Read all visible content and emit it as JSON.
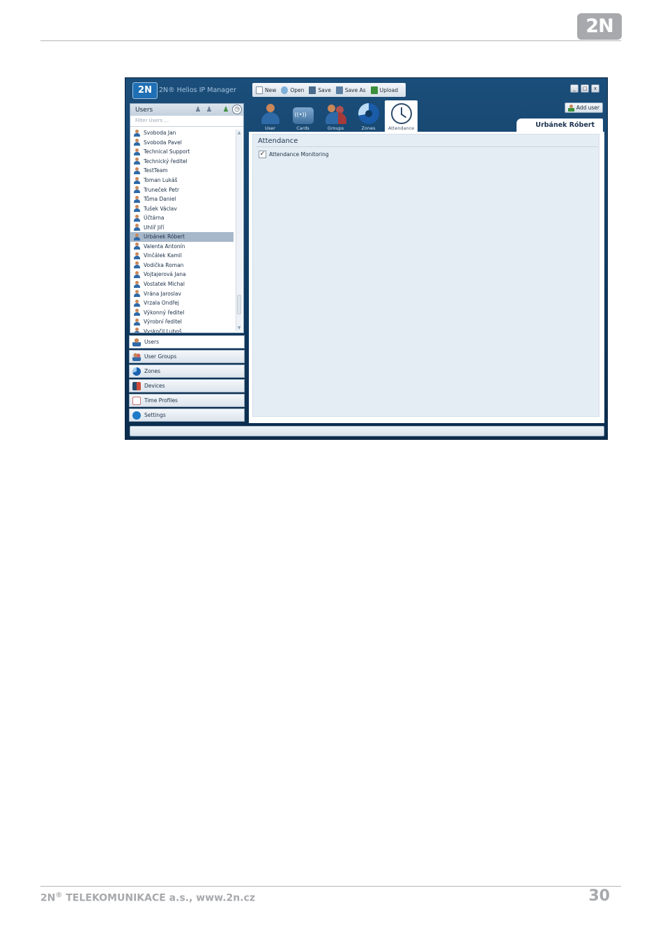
{
  "page": {
    "logo_text": "2N",
    "footer_brand": "2N",
    "footer_reg": "®",
    "footer_rest": " TELEKOMUNIKACE a.s., www.2n.cz",
    "page_number": "30"
  },
  "app": {
    "logo_text": "2N",
    "title": "2N® Helios IP Manager",
    "toolbar": {
      "new": "New",
      "open": "Open",
      "save": "Save",
      "save_as": "Save As",
      "upload": "Upload"
    },
    "window_buttons": [
      "_",
      "□",
      "x"
    ],
    "users_panel": {
      "title": "Users",
      "filter_placeholder": "Filter Users ...",
      "users": [
        "Svoboda Jan",
        "Svoboda Pavel",
        "Technical Support",
        "Technický ředitel",
        "TestTeam",
        "Toman Lukáš",
        "Truneček Petr",
        "Tůma Daniel",
        "Tušek Václav",
        "Účtárna",
        "Uhlíř Jiří",
        "Urbánek Róbert",
        "Valenta Antonín",
        "Vinčálek Kamil",
        "Vodička Roman",
        "Vojtajerová Jana",
        "Vostatek Michal",
        "Vrána Jaroslav",
        "Vrzala Ondřej",
        "Výkonný ředitel",
        "Výrobní ředitel",
        "Vyskočil Luboš"
      ],
      "selected_user": "Urbánek Róbert"
    },
    "nav": {
      "users": "Users",
      "user_groups": "User Groups",
      "zones": "Zones",
      "devices": "Devices",
      "time_profiles": "Time Profiles",
      "settings": "Settings"
    },
    "tabs": {
      "user": "User",
      "cards": "Cards",
      "groups": "Groups",
      "zones": "Zones",
      "attendance": "Attendance"
    },
    "add_user": "Add user",
    "current_user": "Urbánek Róbert",
    "section_title": "Attendance",
    "attendance_monitoring": "Attendance Monitoring",
    "attendance_monitoring_checked": true,
    "check_mark": "✓"
  }
}
